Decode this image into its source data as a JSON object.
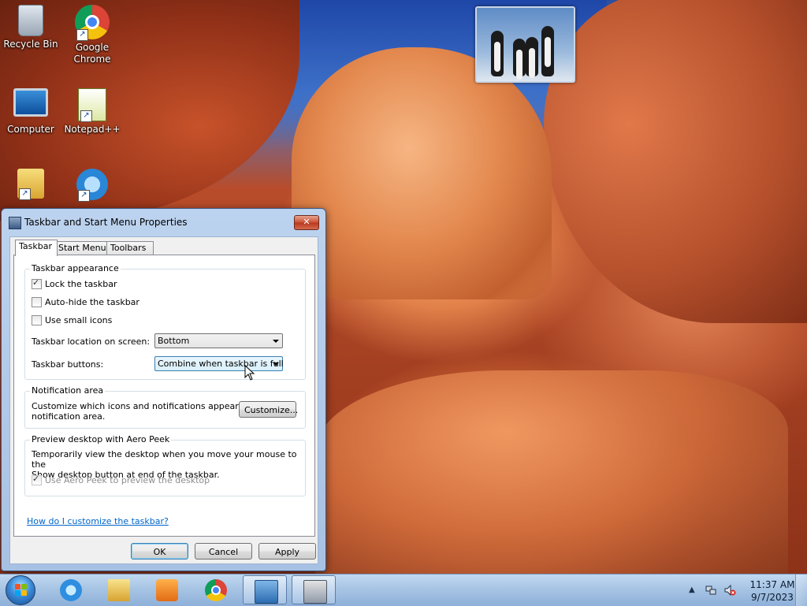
{
  "desktop": {
    "icons": [
      {
        "label": "Recycle Bin"
      },
      {
        "label": "Google Chrome"
      },
      {
        "label": "Computer"
      },
      {
        "label": "Notepad++"
      },
      {
        "label": ""
      },
      {
        "label": ""
      }
    ]
  },
  "dialog": {
    "title": "Taskbar and Start Menu Properties",
    "close_label": "✕",
    "tabs": [
      {
        "label": "Taskbar"
      },
      {
        "label": "Start Menu"
      },
      {
        "label": "Toolbars"
      }
    ],
    "appearance": {
      "title": "Taskbar appearance",
      "lock": {
        "label": "Lock the taskbar",
        "checked": true
      },
      "autohide": {
        "label": "Auto-hide the taskbar",
        "checked": false
      },
      "small_icons": {
        "label": "Use small icons",
        "checked": false
      },
      "location_label": "Taskbar location on screen:",
      "location_value": "Bottom",
      "buttons_label": "Taskbar buttons:",
      "buttons_value": "Combine when taskbar is full"
    },
    "notification": {
      "title": "Notification area",
      "desc_line1": "Customize which icons and notifications appear in the",
      "desc_line2": "notification area.",
      "customize_label": "Customize..."
    },
    "peek": {
      "title": "Preview desktop with Aero Peek",
      "desc_line1": "Temporarily view the desktop when you move your mouse to the",
      "desc_line2": "Show desktop button at end of the taskbar.",
      "use_peek": {
        "label": "Use Aero Peek to preview the desktop",
        "checked": true,
        "disabled": true
      }
    },
    "help_link": "How do I customize the taskbar?",
    "buttons": {
      "ok": "OK",
      "cancel": "Cancel",
      "apply": "Apply"
    }
  },
  "taskbar": {
    "items": [
      {
        "name": "internet-explorer"
      },
      {
        "name": "windows-explorer"
      },
      {
        "name": "windows-media-player"
      },
      {
        "name": "google-chrome"
      },
      {
        "name": "control-panel",
        "active": true
      },
      {
        "name": "taskbar-properties",
        "active": true
      }
    ],
    "clock": {
      "time": "11:37 AM",
      "date": "9/7/2023"
    }
  }
}
